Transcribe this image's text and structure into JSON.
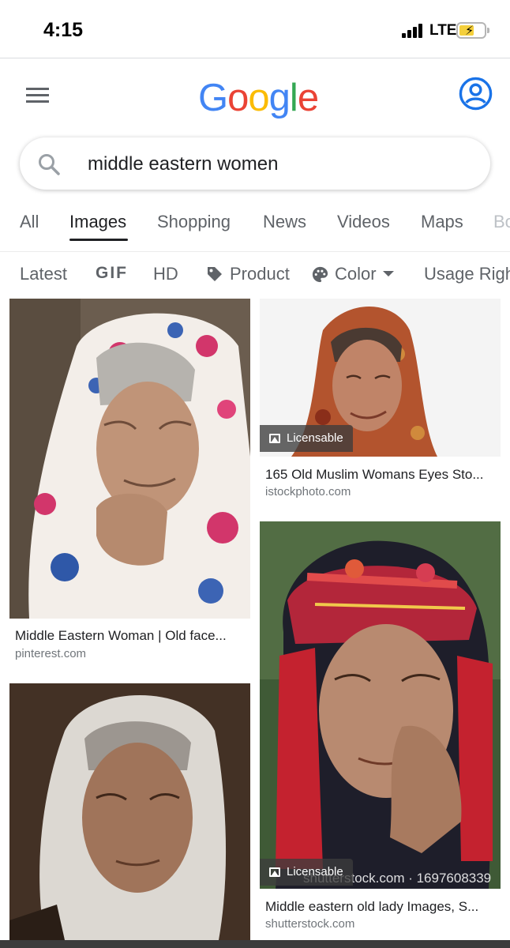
{
  "status_bar": {
    "time": "4:15",
    "network": "LTE"
  },
  "header": {
    "logo_letters": [
      "G",
      "o",
      "o",
      "g",
      "l",
      "e"
    ],
    "logo_colors": [
      "#4285F4",
      "#EA4335",
      "#FBBC05",
      "#4285F4",
      "#34A853",
      "#EA4335"
    ]
  },
  "search": {
    "query": "middle eastern women"
  },
  "tabs": [
    "All",
    "Images",
    "Shopping",
    "News",
    "Videos",
    "Maps",
    "Bo"
  ],
  "active_tab": "Images",
  "filters": [
    "Latest",
    "GIF",
    "HD",
    "Product",
    "Color",
    "Usage Righ"
  ],
  "results": [
    {
      "title": "Middle Eastern Woman | Old face...",
      "source": "pinterest.com",
      "licensable": false,
      "image": "woman-white-floral-headscarf"
    },
    {
      "title": "165 Old Muslim Womans Eyes Sto...",
      "source": "istockphoto.com",
      "licensable": true,
      "badge": "Licensable",
      "image": "woman-red-headscarf"
    },
    {
      "title": "",
      "source": "",
      "licensable": false,
      "image": "woman-white-veil-portrait"
    },
    {
      "title": "Middle eastern old lady Images, S...",
      "source": "shutterstock.com",
      "licensable": true,
      "badge": "Licensable",
      "watermark": "shutterstock.com · 1697608339",
      "image": "woman-red-turban"
    }
  ],
  "colors": {
    "accent_blue": "#1a73e8",
    "text_gray": "#5f6368"
  }
}
